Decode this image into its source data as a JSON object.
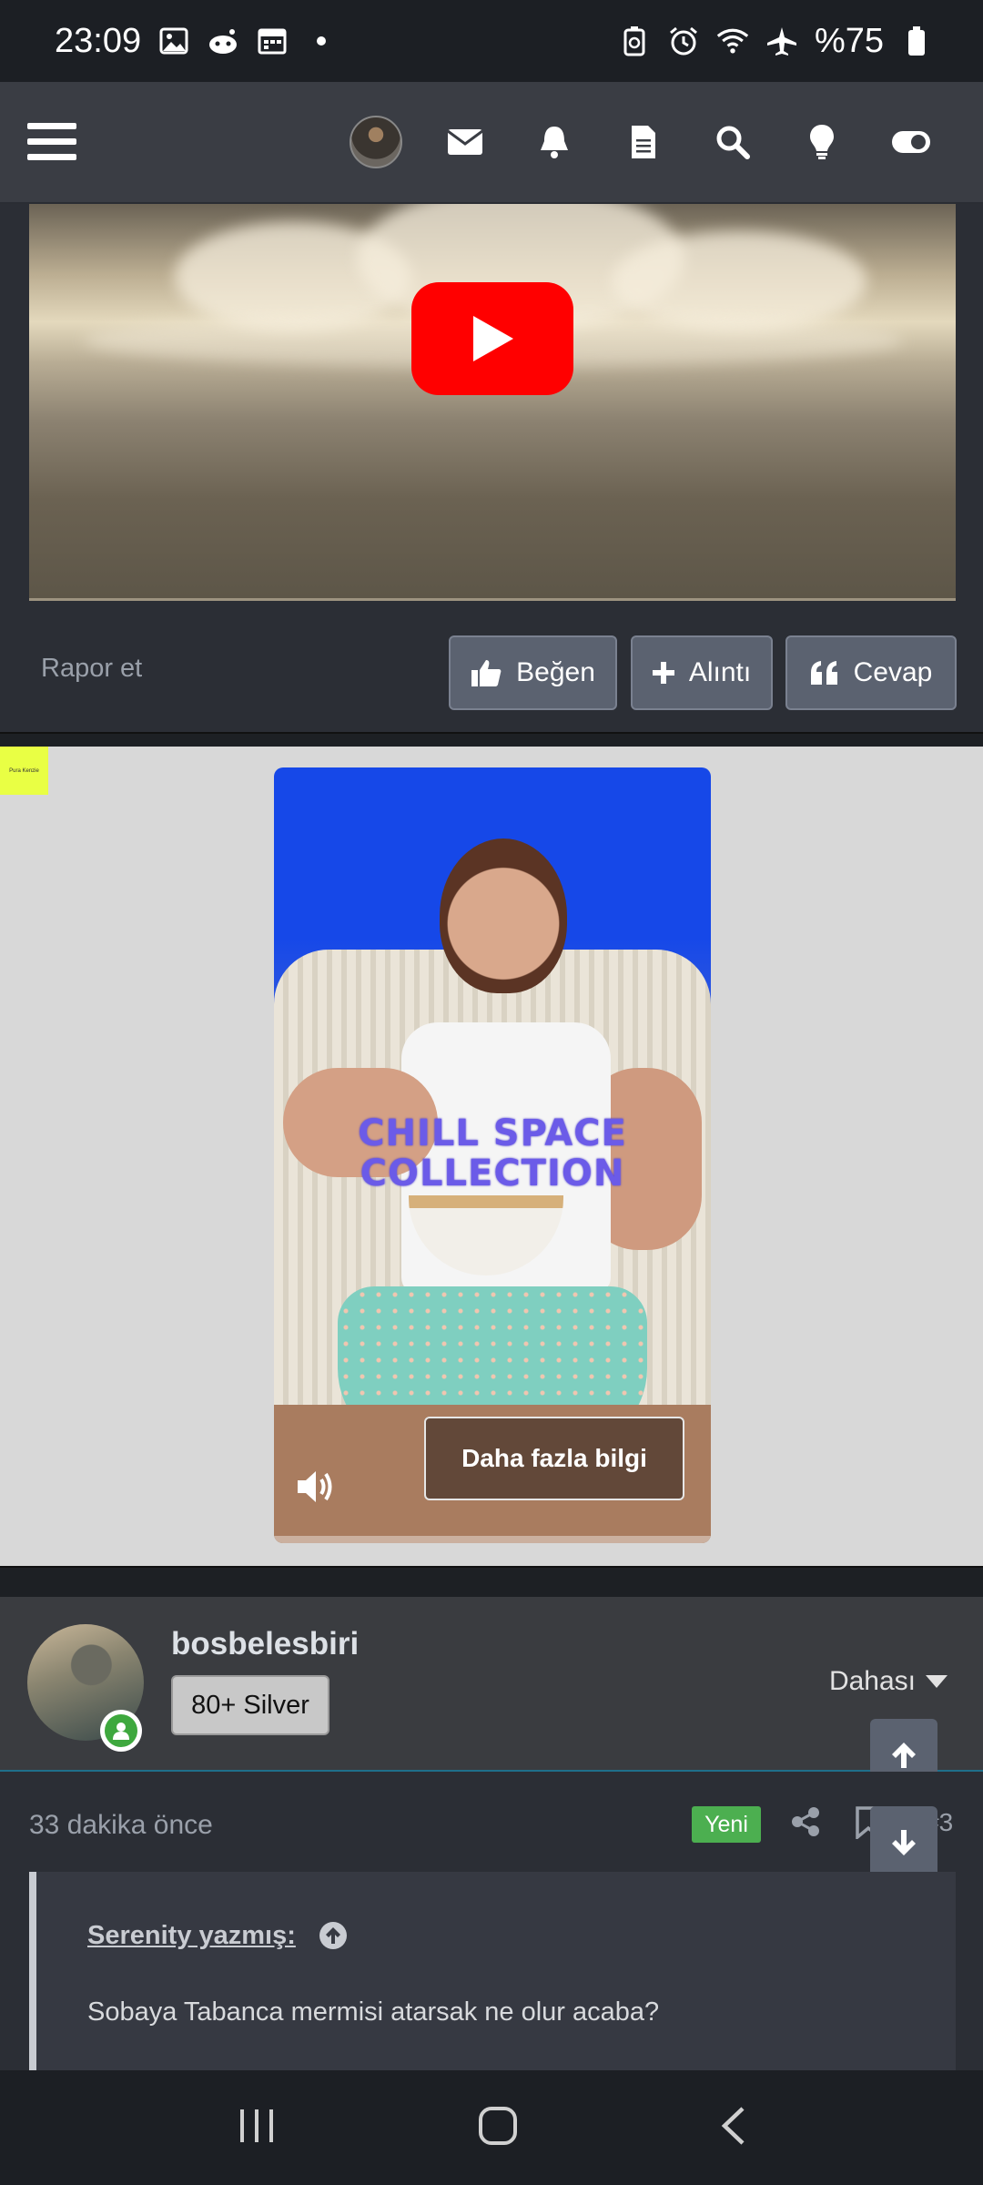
{
  "status_bar": {
    "time": "23:09",
    "battery": "%75",
    "left_icons": [
      "gallery-icon",
      "reddit-icon",
      "calendar-icon",
      "dot-icon"
    ],
    "right_icons": [
      "battery-saver-icon",
      "alarm-icon",
      "wifi-icon",
      "airplane-icon",
      "battery-icon"
    ]
  },
  "navbar": {
    "icons": [
      "menu-icon",
      "avatar",
      "mail-icon",
      "bell-icon",
      "document-icon",
      "search-icon",
      "lightbulb-icon",
      "toggle-icon"
    ]
  },
  "post_actions": {
    "report": "Rapor et",
    "like": "Beğen",
    "quote": "Alıntı",
    "reply": "Cevap"
  },
  "ad": {
    "badge": "Pura Kenzie",
    "overlay_text": "CHILL SPACE COLLECTION",
    "cta": "Daha fazla bilgi"
  },
  "user": {
    "name": "bosbelesbiri",
    "rank": "80+ Silver",
    "more": "Dahası"
  },
  "post_meta": {
    "time": "33 dakika önce",
    "new_badge": "Yeni",
    "post_number": "#3"
  },
  "quote": {
    "author": "Serenity yazmış:",
    "text": "Sobaya Tabanca mermisi atarsak ne olur acaba?"
  },
  "colors": {
    "accent": "#5b6270",
    "youtube": "#ff0000",
    "new_badge": "#4caf50",
    "online": "#3ea83e"
  }
}
